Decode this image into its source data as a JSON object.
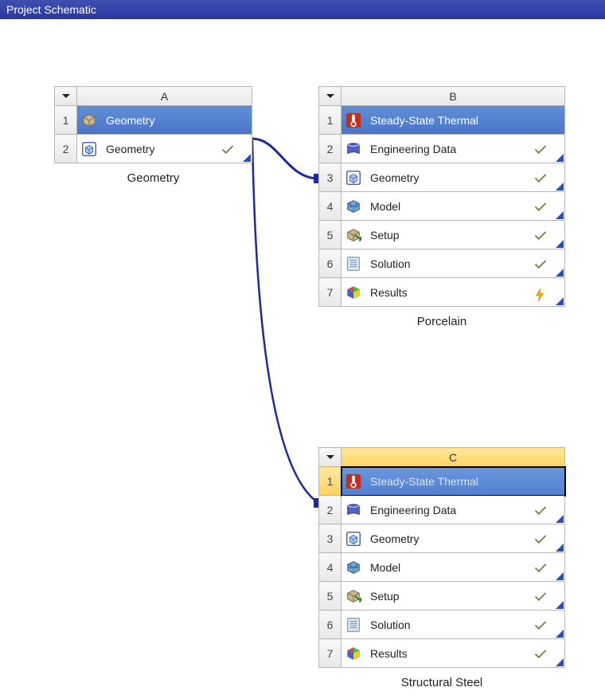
{
  "window": {
    "title": "Project Schematic"
  },
  "columns": {
    "A": "A",
    "B": "B",
    "C": "C"
  },
  "blockA": {
    "caption": "Geometry",
    "rows": [
      {
        "n": "1",
        "label": "Geometry",
        "icon": "geometry-comp-icon",
        "title": true
      },
      {
        "n": "2",
        "label": "Geometry",
        "icon": "geometry-cell-icon",
        "status": "check"
      }
    ]
  },
  "blockB": {
    "caption": "Porcelain",
    "rows": [
      {
        "n": "1",
        "label": "Steady-State Thermal",
        "icon": "thermal-icon",
        "title": true
      },
      {
        "n": "2",
        "label": "Engineering Data",
        "icon": "engdata-icon",
        "status": "check"
      },
      {
        "n": "3",
        "label": "Geometry",
        "icon": "geometry-cell-icon",
        "status": "check"
      },
      {
        "n": "4",
        "label": "Model",
        "icon": "model-icon",
        "status": "check"
      },
      {
        "n": "5",
        "label": "Setup",
        "icon": "setup-icon",
        "status": "check"
      },
      {
        "n": "6",
        "label": "Solution",
        "icon": "solution-icon",
        "status": "check"
      },
      {
        "n": "7",
        "label": "Results",
        "icon": "results-icon",
        "status": "bolt"
      }
    ]
  },
  "blockC": {
    "caption": "Structural Steel",
    "selected": true,
    "rows": [
      {
        "n": "1",
        "label": "Steady-State Thermal",
        "icon": "thermal-icon",
        "title": true,
        "focused": true
      },
      {
        "n": "2",
        "label": "Engineering Data",
        "icon": "engdata-icon",
        "status": "check"
      },
      {
        "n": "3",
        "label": "Geometry",
        "icon": "geometry-cell-icon",
        "status": "check"
      },
      {
        "n": "4",
        "label": "Model",
        "icon": "model-icon",
        "status": "check"
      },
      {
        "n": "5",
        "label": "Setup",
        "icon": "setup-icon",
        "status": "check"
      },
      {
        "n": "6",
        "label": "Solution",
        "icon": "solution-icon",
        "status": "check"
      },
      {
        "n": "7",
        "label": "Results",
        "icon": "results-icon",
        "status": "check"
      }
    ]
  }
}
